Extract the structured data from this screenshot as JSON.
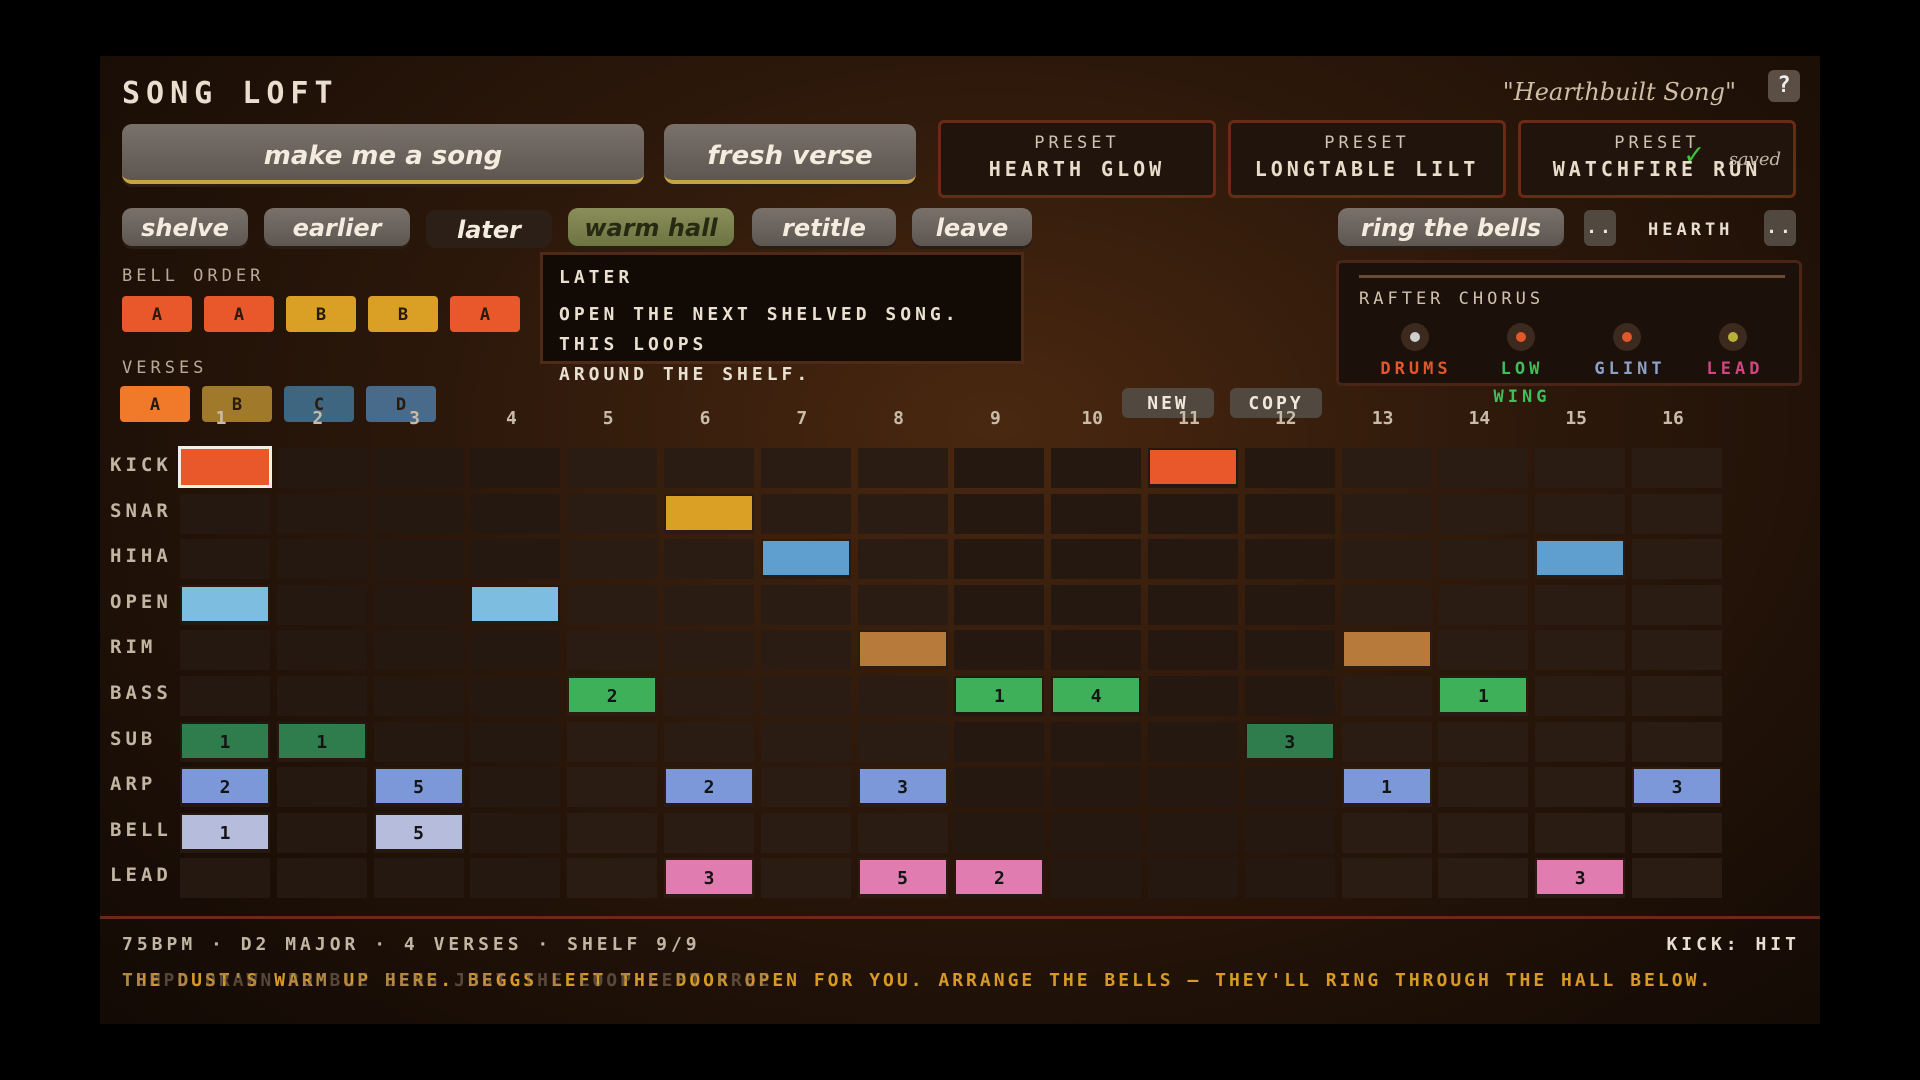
{
  "app": {
    "title": "SONG LOFT",
    "song_name": "\"Hearthbuilt Song\"",
    "help": "?"
  },
  "big_buttons": [
    {
      "label": "make me a song"
    },
    {
      "label": "fresh verse"
    }
  ],
  "presets": [
    {
      "label": "PRESET",
      "name": "HEARTH GLOW"
    },
    {
      "label": "PRESET",
      "name": "LONGTABLE LILT"
    },
    {
      "label": "PRESET",
      "name": "WATCHFIRE RUN"
    }
  ],
  "saved_label": "saved",
  "actions": [
    {
      "label": "shelve"
    },
    {
      "label": "earlier"
    },
    {
      "label": "later"
    },
    {
      "label": "warm hall"
    },
    {
      "label": "retitle"
    },
    {
      "label": "leave"
    }
  ],
  "bells_button": "ring the bells",
  "hall": {
    "prev": "..",
    "name": "HEARTH",
    "next": ".."
  },
  "bell_order": {
    "label": "BELL ORDER",
    "items": [
      "A",
      "A",
      "B",
      "B",
      "A"
    ]
  },
  "verses": {
    "label": "VERSES",
    "items": [
      "A",
      "B",
      "C",
      "D"
    ]
  },
  "tooltip": {
    "title": "LATER",
    "text_line1": "OPEN THE NEXT SHELVED SONG. THIS LOOPS",
    "text_line2": "AROUND THE SHELF."
  },
  "chorus": {
    "title": "RAFTER CHORUS",
    "members": [
      {
        "name": "DRUMS",
        "color": "#e2582a"
      },
      {
        "name": "LOW",
        "sub": "WING",
        "color": "#3fbf5a"
      },
      {
        "name": "GLINT",
        "color": "#8ca0c8"
      },
      {
        "name": "LEAD",
        "color": "#d0457f"
      }
    ]
  },
  "pattern_buttons": {
    "new": "NEW",
    "copy": "COPY"
  },
  "columns": [
    "1",
    "2",
    "3",
    "4",
    "5",
    "6",
    "7",
    "8",
    "9",
    "10",
    "11",
    "12",
    "13",
    "14",
    "15",
    "16"
  ],
  "tracks": [
    {
      "name": "KICK",
      "color": "#e8582a",
      "notes": [
        {
          "step": 1,
          "v": ""
        },
        {
          "step": 11,
          "v": ""
        }
      ]
    },
    {
      "name": "SNAR",
      "color": "#d9a025",
      "notes": [
        {
          "step": 6,
          "v": ""
        }
      ]
    },
    {
      "name": "HIHA",
      "color": "#5f9fcf",
      "notes": [
        {
          "step": 7,
          "v": ""
        },
        {
          "step": 15,
          "v": ""
        }
      ]
    },
    {
      "name": "OPEN",
      "color": "#7cbde0",
      "notes": [
        {
          "step": 1,
          "v": ""
        },
        {
          "step": 4,
          "v": ""
        }
      ]
    },
    {
      "name": "RIM",
      "color": "#b87a3a",
      "notes": [
        {
          "step": 8,
          "v": ""
        },
        {
          "step": 13,
          "v": ""
        }
      ]
    },
    {
      "name": "BASS",
      "color": "#3fb05a",
      "notes": [
        {
          "step": 5,
          "v": "2"
        },
        {
          "step": 9,
          "v": "1"
        },
        {
          "step": 10,
          "v": "4"
        },
        {
          "step": 14,
          "v": "1"
        }
      ]
    },
    {
      "name": "SUB",
      "color": "#2f7c4c",
      "notes": [
        {
          "step": 1,
          "v": "1"
        },
        {
          "step": 2,
          "v": "1"
        },
        {
          "step": 12,
          "v": "3"
        }
      ]
    },
    {
      "name": "ARP",
      "color": "#7c98d8",
      "notes": [
        {
          "step": 1,
          "v": "2"
        },
        {
          "step": 3,
          "v": "5"
        },
        {
          "step": 6,
          "v": "2"
        },
        {
          "step": 8,
          "v": "3"
        },
        {
          "step": 13,
          "v": "1"
        },
        {
          "step": 16,
          "v": "3"
        }
      ]
    },
    {
      "name": "BELL",
      "color": "#b5bcdc",
      "notes": [
        {
          "step": 1,
          "v": "1"
        },
        {
          "step": 3,
          "v": "5"
        }
      ]
    },
    {
      "name": "LEAD",
      "color": "#e07cb0",
      "notes": [
        {
          "step": 6,
          "v": "3"
        },
        {
          "step": 8,
          "v": "5"
        },
        {
          "step": 9,
          "v": "2"
        },
        {
          "step": 15,
          "v": "3"
        }
      ]
    }
  ],
  "selected": {
    "track": 0,
    "step": 1
  },
  "status": "75BPM · D2 MAJOR · 4 VERSES · SHELF 9/9",
  "kick_hit": "KICK: HIT",
  "message": "THE DUST'S WARM UP HERE. BEGGS LEFT THE DOOR OPEN FOR YOU. ARRANGE THE BELLS — THEY'LL RING THROUGH THE HALL BELOW.",
  "message_ghost": "TEMPO DRAWN RUMBLE BENG JUST THE LOOP LEFT FREE"
}
